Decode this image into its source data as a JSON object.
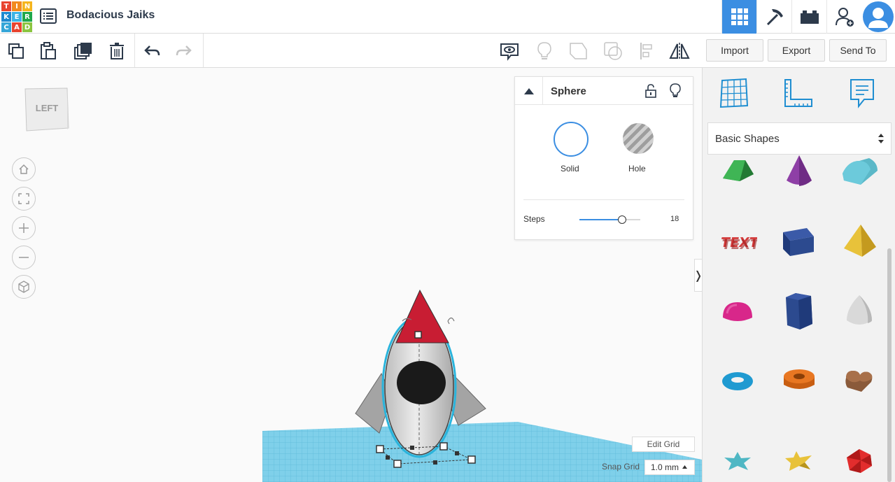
{
  "app": {
    "logo_letters": [
      "T",
      "I",
      "N",
      "K",
      "E",
      "R",
      "C",
      "A",
      "D"
    ],
    "logo_colors": [
      "#e8442f",
      "#f28a1e",
      "#f5b51d",
      "#1e8ad1",
      "#3bb3e5",
      "#20a84a",
      "#35a6d8",
      "#e8442f",
      "#8bc540"
    ],
    "title": "Bodacious Jaiks"
  },
  "topnav": {
    "items": [
      {
        "name": "3d-design-view-icon",
        "active": true
      },
      {
        "name": "blocks-pickaxe-icon",
        "active": false
      },
      {
        "name": "bricks-icon",
        "active": false
      },
      {
        "name": "add-user-icon",
        "active": false
      },
      {
        "name": "avatar",
        "active": false
      }
    ],
    "accent": "#3b8ee2"
  },
  "toolbar": {
    "import_label": "Import",
    "export_label": "Export",
    "send_label": "Send To"
  },
  "viewcube": {
    "face_label": "LEFT"
  },
  "inspector": {
    "shape_name": "Sphere",
    "solid_label": "Solid",
    "hole_label": "Hole",
    "steps_label": "Steps",
    "steps_value": "18",
    "steps_fraction": 0.7
  },
  "grid": {
    "edit_label": "Edit Grid",
    "snap_label": "Snap Grid",
    "snap_value": "1.0 mm"
  },
  "sidebar": {
    "category": "Basic Shapes",
    "shapes": [
      {
        "name": "roof",
        "color": "#2f9e44"
      },
      {
        "name": "cone",
        "color": "#8e3fa6"
      },
      {
        "name": "round-roof",
        "color": "#5bb8c8"
      },
      {
        "name": "text",
        "color": "#d33a3a"
      },
      {
        "name": "box",
        "color": "#2c4a8f"
      },
      {
        "name": "pyramid",
        "color": "#e8c23a"
      },
      {
        "name": "half-sphere",
        "color": "#d8278a"
      },
      {
        "name": "polygon",
        "color": "#2c4a8f"
      },
      {
        "name": "paraboloid",
        "color": "#d9d9d9"
      },
      {
        "name": "torus",
        "color": "#1f9ad1"
      },
      {
        "name": "tube",
        "color": "#e87722"
      },
      {
        "name": "heart",
        "color": "#8a5a3a"
      },
      {
        "name": "star-six",
        "color": "#4fb7c4"
      },
      {
        "name": "star",
        "color": "#e8c23a"
      },
      {
        "name": "icosahedron",
        "color": "#e22d2d"
      }
    ]
  }
}
